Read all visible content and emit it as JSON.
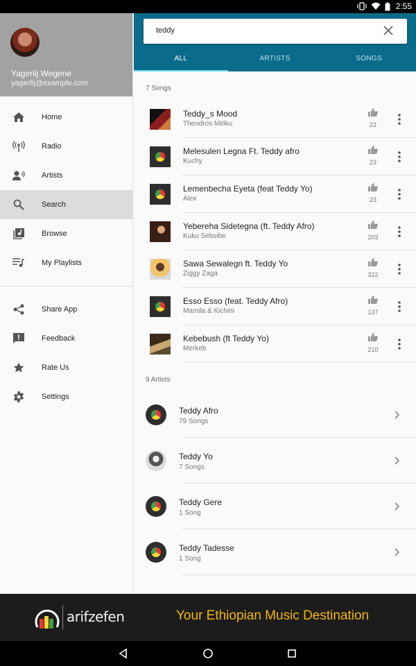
{
  "status_bar": {
    "time": "2:55"
  },
  "drawer": {
    "user_name": "Yagerlij Wegene",
    "user_email": "yagerlij@example.com",
    "items": [
      {
        "label": "Home",
        "icon": "home-icon"
      },
      {
        "label": "Radio",
        "icon": "radio-icon"
      },
      {
        "label": "Artists",
        "icon": "artist-icon"
      },
      {
        "label": "Search",
        "icon": "search-icon",
        "active": true
      },
      {
        "label": "Browse",
        "icon": "browse-icon"
      },
      {
        "label": "My Playlists",
        "icon": "playlist-icon"
      }
    ],
    "secondary_items": [
      {
        "label": "Share App",
        "icon": "share-icon"
      },
      {
        "label": "Feedback",
        "icon": "feedback-icon"
      },
      {
        "label": "Rate Us",
        "icon": "star-icon"
      },
      {
        "label": "Settings",
        "icon": "gear-icon"
      }
    ]
  },
  "search": {
    "query": "teddy"
  },
  "tabs": [
    {
      "label": "ALL",
      "active": true
    },
    {
      "label": "ARTISTS"
    },
    {
      "label": "SONGS"
    }
  ],
  "songs_section": {
    "title": "7 Songs",
    "items": [
      {
        "title": "Teddy_s Mood",
        "artist": "Theodros Mitiku",
        "likes": "22"
      },
      {
        "title": "Melesulen Legna Ft. Teddy afro",
        "artist": "Kuchy",
        "likes": "23"
      },
      {
        "title": "Lemenbecha Eyeta (feat Teddy Yo)",
        "artist": "Alex",
        "likes": "23"
      },
      {
        "title": "Yebereha Sidetegna (ft. Teddy Afro)",
        "artist": "Kuku Sebsibe",
        "likes": "203"
      },
      {
        "title": "Sawa Sewalegn ft. Teddy Yo",
        "artist": "Ziggy Zaga",
        "likes": "322"
      },
      {
        "title": "Esso Esso (feat. Teddy Afro)",
        "artist": "Mamila & Kichini",
        "likes": "137"
      },
      {
        "title": "Kebebush (ft Teddy Yo)",
        "artist": "Merkeb",
        "likes": "210"
      }
    ]
  },
  "artists_section": {
    "title": "9 Artists",
    "items": [
      {
        "name": "Teddy Afro",
        "count": "79 Songs"
      },
      {
        "name": "Teddy Yo",
        "count": "7 Songs"
      },
      {
        "name": "Teddy Gere",
        "count": "1 Song"
      },
      {
        "name": "Teddy Tadesse",
        "count": "1 Song"
      }
    ]
  },
  "banner": {
    "brand": "arifzefen",
    "tagline": "Your Ethiopian Music Destination"
  },
  "colors": {
    "toolbar": "#0b6b8b",
    "tab_indicator": "#6dd4f3",
    "banner_text": "#f5b800"
  }
}
